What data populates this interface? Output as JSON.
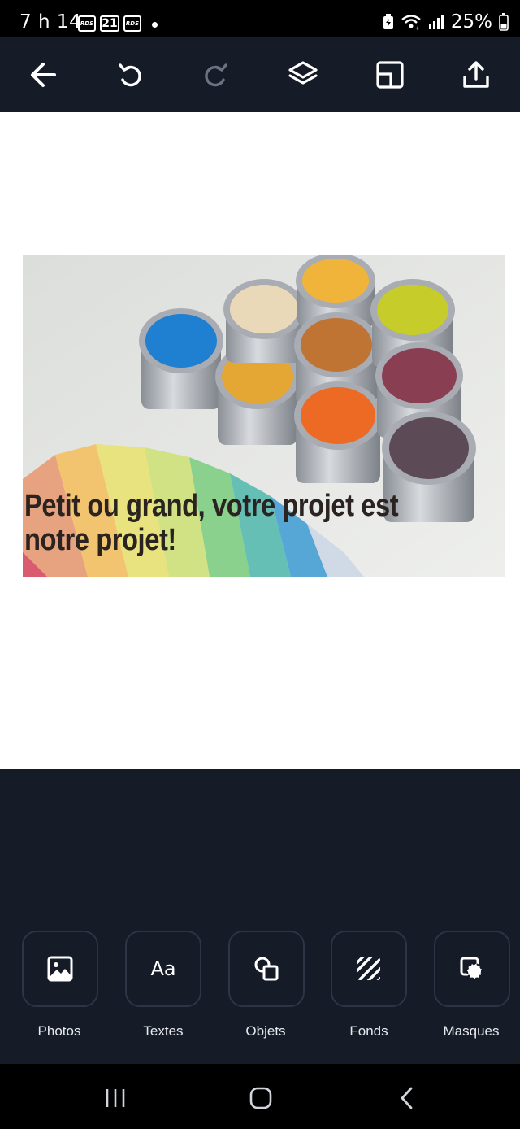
{
  "status_bar": {
    "time": "7 h 14",
    "date_badge": "21",
    "app_badge_1": "RDS",
    "app_badge_2": "RDS",
    "battery": "25%"
  },
  "toolbar": {
    "icons": [
      "back-arrow-icon",
      "undo-icon",
      "redo-icon",
      "layers-icon",
      "resize-icon",
      "share-icon"
    ]
  },
  "design": {
    "text": "Petit ou grand, votre projet est notre projet!"
  },
  "tools": [
    {
      "label": "Photos",
      "icon": "photo-icon"
    },
    {
      "label": "Textes",
      "icon": "text-icon",
      "glyph": "Aa"
    },
    {
      "label": "Objets",
      "icon": "shapes-icon"
    },
    {
      "label": "Fonds",
      "icon": "background-icon"
    },
    {
      "label": "Masques",
      "icon": "mask-icon"
    }
  ],
  "colors": {
    "dark_bg": "#151b27",
    "tile_border": "#2c3445",
    "canvas": "#ffffff"
  }
}
